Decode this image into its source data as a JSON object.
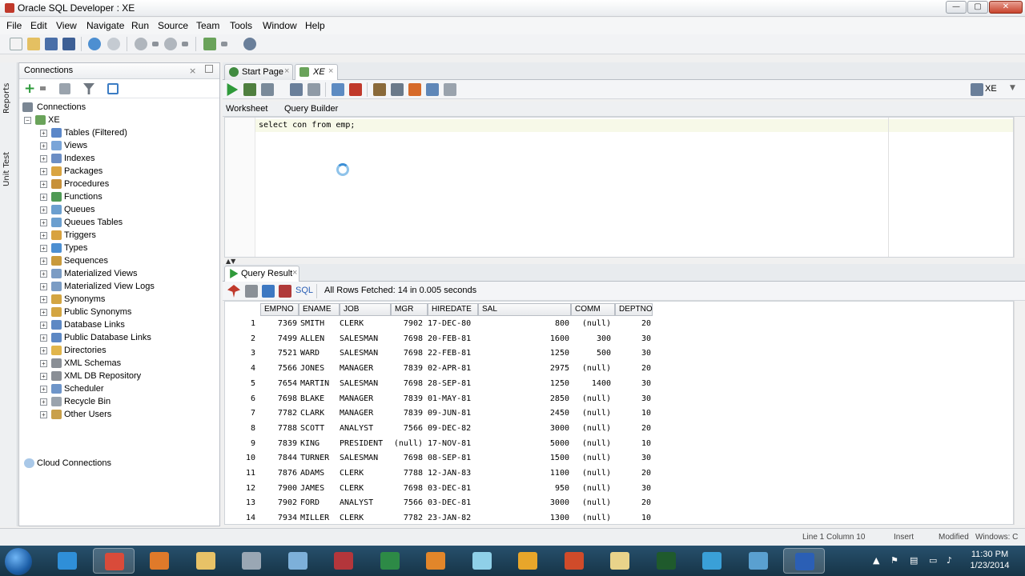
{
  "window": {
    "title": "Oracle SQL Developer : XE",
    "controls": [
      "—",
      "▢",
      "✕"
    ]
  },
  "menu": [
    "File",
    "Edit",
    "View",
    "Navigate",
    "Run",
    "Source",
    "Team",
    "Tools",
    "Window",
    "Help"
  ],
  "side_tabs": [
    "Reports",
    "Unit Test"
  ],
  "connections": {
    "title": "Connections",
    "root": "Connections",
    "connection": "XE",
    "items": [
      {
        "label": "Tables (Filtered)",
        "icon": "table-icon",
        "color": "#5b87c9"
      },
      {
        "label": "Views",
        "icon": "view-icon",
        "color": "#7aa5d8"
      },
      {
        "label": "Indexes",
        "icon": "index-icon",
        "color": "#6c8ec4"
      },
      {
        "label": "Packages",
        "icon": "package-icon",
        "color": "#d9a441"
      },
      {
        "label": "Procedures",
        "icon": "procedure-icon",
        "color": "#c7913a"
      },
      {
        "label": "Functions",
        "icon": "function-icon",
        "color": "#4f9a55"
      },
      {
        "label": "Queues",
        "icon": "queue-icon",
        "color": "#6b9fcf"
      },
      {
        "label": "Queues Tables",
        "icon": "queue-table-icon",
        "color": "#6b9fcf"
      },
      {
        "label": "Triggers",
        "icon": "trigger-icon",
        "color": "#d8a23f"
      },
      {
        "label": "Types",
        "icon": "type-icon",
        "color": "#4d8fd1"
      },
      {
        "label": "Sequences",
        "icon": "sequence-icon",
        "color": "#c99a3c"
      },
      {
        "label": "Materialized Views",
        "icon": "materialized-view-icon",
        "color": "#7b9cc4"
      },
      {
        "label": "Materialized View Logs",
        "icon": "materialized-view-log-icon",
        "color": "#7b9cc4"
      },
      {
        "label": "Synonyms",
        "icon": "synonym-icon",
        "color": "#d3a542"
      },
      {
        "label": "Public Synonyms",
        "icon": "public-synonym-icon",
        "color": "#d3a542"
      },
      {
        "label": "Database Links",
        "icon": "database-link-icon",
        "color": "#5d88c4"
      },
      {
        "label": "Public Database Links",
        "icon": "public-database-link-icon",
        "color": "#5d88c4"
      },
      {
        "label": "Directories",
        "icon": "directory-icon",
        "color": "#e1b54b"
      },
      {
        "label": "XML Schemas",
        "icon": "xml-schema-icon",
        "color": "#8a8f96"
      },
      {
        "label": "XML DB Repository",
        "icon": "xml-db-repository-icon",
        "color": "#8a8f96"
      },
      {
        "label": "Scheduler",
        "icon": "scheduler-icon",
        "color": "#6e95c9"
      },
      {
        "label": "Recycle Bin",
        "icon": "recycle-bin-icon",
        "color": "#9aa3ad"
      },
      {
        "label": "Other Users",
        "icon": "other-users-icon",
        "color": "#c9a04a"
      }
    ],
    "cloud": "Cloud Connections"
  },
  "doc_tabs": [
    {
      "label": "Start Page",
      "active": false
    },
    {
      "label": "XE",
      "active": true
    }
  ],
  "connection_selector": "XE",
  "sub_tabs": [
    "Worksheet",
    "Query Builder"
  ],
  "editor": {
    "sql": "select con from emp;"
  },
  "result": {
    "tab": "Query Result",
    "sql_label": "SQL",
    "status": "All Rows Fetched: 14 in 0.005 seconds",
    "columns": [
      "EMPNO",
      "ENAME",
      "JOB",
      "MGR",
      "HIREDATE",
      "SAL",
      "COMM",
      "DEPTNO"
    ],
    "rows": [
      [
        "1",
        "7369",
        "SMITH",
        "CLERK",
        "7902",
        "17-DEC-80",
        "800",
        "(null)",
        "20"
      ],
      [
        "2",
        "7499",
        "ALLEN",
        "SALESMAN",
        "7698",
        "20-FEB-81",
        "1600",
        "300",
        "30"
      ],
      [
        "3",
        "7521",
        "WARD",
        "SALESMAN",
        "7698",
        "22-FEB-81",
        "1250",
        "500",
        "30"
      ],
      [
        "4",
        "7566",
        "JONES",
        "MANAGER",
        "7839",
        "02-APR-81",
        "2975",
        "(null)",
        "20"
      ],
      [
        "5",
        "7654",
        "MARTIN",
        "SALESMAN",
        "7698",
        "28-SEP-81",
        "1250",
        "1400",
        "30"
      ],
      [
        "6",
        "7698",
        "BLAKE",
        "MANAGER",
        "7839",
        "01-MAY-81",
        "2850",
        "(null)",
        "30"
      ],
      [
        "7",
        "7782",
        "CLARK",
        "MANAGER",
        "7839",
        "09-JUN-81",
        "2450",
        "(null)",
        "10"
      ],
      [
        "8",
        "7788",
        "SCOTT",
        "ANALYST",
        "7566",
        "09-DEC-82",
        "3000",
        "(null)",
        "20"
      ],
      [
        "9",
        "7839",
        "KING",
        "PRESIDENT",
        "(null)",
        "17-NOV-81",
        "5000",
        "(null)",
        "10"
      ],
      [
        "10",
        "7844",
        "TURNER",
        "SALESMAN",
        "7698",
        "08-SEP-81",
        "1500",
        "(null)",
        "30"
      ],
      [
        "11",
        "7876",
        "ADAMS",
        "CLERK",
        "7788",
        "12-JAN-83",
        "1100",
        "(null)",
        "20"
      ],
      [
        "12",
        "7900",
        "JAMES",
        "CLERK",
        "7698",
        "03-DEC-81",
        "950",
        "(null)",
        "30"
      ],
      [
        "13",
        "7902",
        "FORD",
        "ANALYST",
        "7566",
        "03-DEC-81",
        "3000",
        "(null)",
        "20"
      ],
      [
        "14",
        "7934",
        "MILLER",
        "CLERK",
        "7782",
        "23-JAN-82",
        "1300",
        "(null)",
        "10"
      ]
    ]
  },
  "status_bar": {
    "position": "Line 1 Column 10",
    "mode": "Insert",
    "modified": "Modified",
    "line_endings": "Windows: C"
  },
  "taskbar": {
    "time": "11:30 PM",
    "date": "1/23/2014",
    "apps": [
      {
        "name": "internet-explorer",
        "color": "#2f8fd8"
      },
      {
        "name": "chrome",
        "color": "#d94b3a"
      },
      {
        "name": "firefox",
        "color": "#e07a2a"
      },
      {
        "name": "file-explorer",
        "color": "#e8c267"
      },
      {
        "name": "calculator",
        "color": "#9aa7b4"
      },
      {
        "name": "notepad",
        "color": "#7db0d9"
      },
      {
        "name": "access",
        "color": "#b3363b"
      },
      {
        "name": "excel",
        "color": "#2d8a46"
      },
      {
        "name": "media-player",
        "color": "#e2862a"
      },
      {
        "name": "folder",
        "color": "#8fd0e8"
      },
      {
        "name": "outlook",
        "color": "#e8a62a"
      },
      {
        "name": "powerpoint",
        "color": "#d04b2a"
      },
      {
        "name": "pen-tool",
        "color": "#e9d38a"
      },
      {
        "name": "command-prompt",
        "color": "#1f5a2c"
      },
      {
        "name": "remote-desktop",
        "color": "#3aa0d8"
      },
      {
        "name": "sql-developer-task",
        "color": "#5aa0d0"
      },
      {
        "name": "active-window",
        "color": "#2b5fb5"
      }
    ]
  }
}
